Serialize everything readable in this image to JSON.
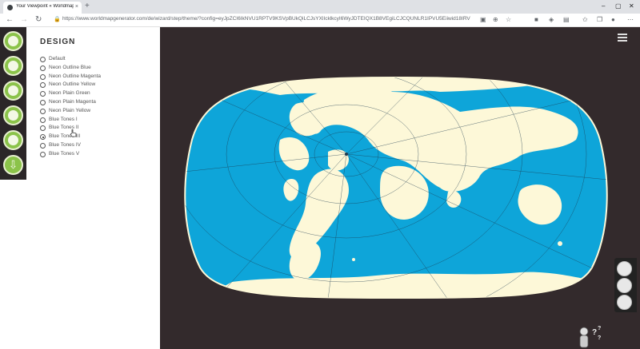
{
  "browser": {
    "tab_title": "Your Viewpoint « Worldmapgen...",
    "tab_close": "×",
    "new_tab": "+",
    "url": "https://www.worldmapgenerator.com/de/wizard/step/theme/?config=eyJpZCI6IkNVU1RPTV9KSVpBUkQiLCJsYXlIcklkcyI6WyJDTEIQX1B8VEgiLCJCQUNLR1IPVU5Eiiwid18IRVJ...",
    "icons": [
      "back-icon",
      "forward-icon",
      "reload-icon",
      "lock-icon",
      "read-icon",
      "translate-icon",
      "favorite-icon",
      "collections-icon",
      "extension-icon",
      "profile-icon",
      "more-icon"
    ]
  },
  "steps": [
    "location-step",
    "viewpoint-step",
    "projection-step",
    "design-step",
    "labels-step",
    "download-step"
  ],
  "panel": {
    "heading": "DESIGN",
    "options": [
      {
        "label": "Default",
        "selected": false
      },
      {
        "label": "Neon Outline Blue",
        "selected": false
      },
      {
        "label": "Neon Outline Magenta",
        "selected": false
      },
      {
        "label": "Neon Outline Yellow",
        "selected": false
      },
      {
        "label": "Neon Plain Green",
        "selected": false
      },
      {
        "label": "Neon Plain Magenta",
        "selected": false
      },
      {
        "label": "Neon Plain Yellow",
        "selected": false
      },
      {
        "label": "Blue Tones I",
        "selected": false
      },
      {
        "label": "Blue Tones II",
        "selected": false
      },
      {
        "label": "Blue Tones III",
        "selected": true
      },
      {
        "label": "Blue Tones IV",
        "selected": false
      },
      {
        "label": "Blue Tones V",
        "selected": false
      }
    ]
  },
  "colors": {
    "ocean": "#0ea5d9",
    "land": "#fdf8d8",
    "background": "#332a2c",
    "accent": "#8bc34a"
  }
}
